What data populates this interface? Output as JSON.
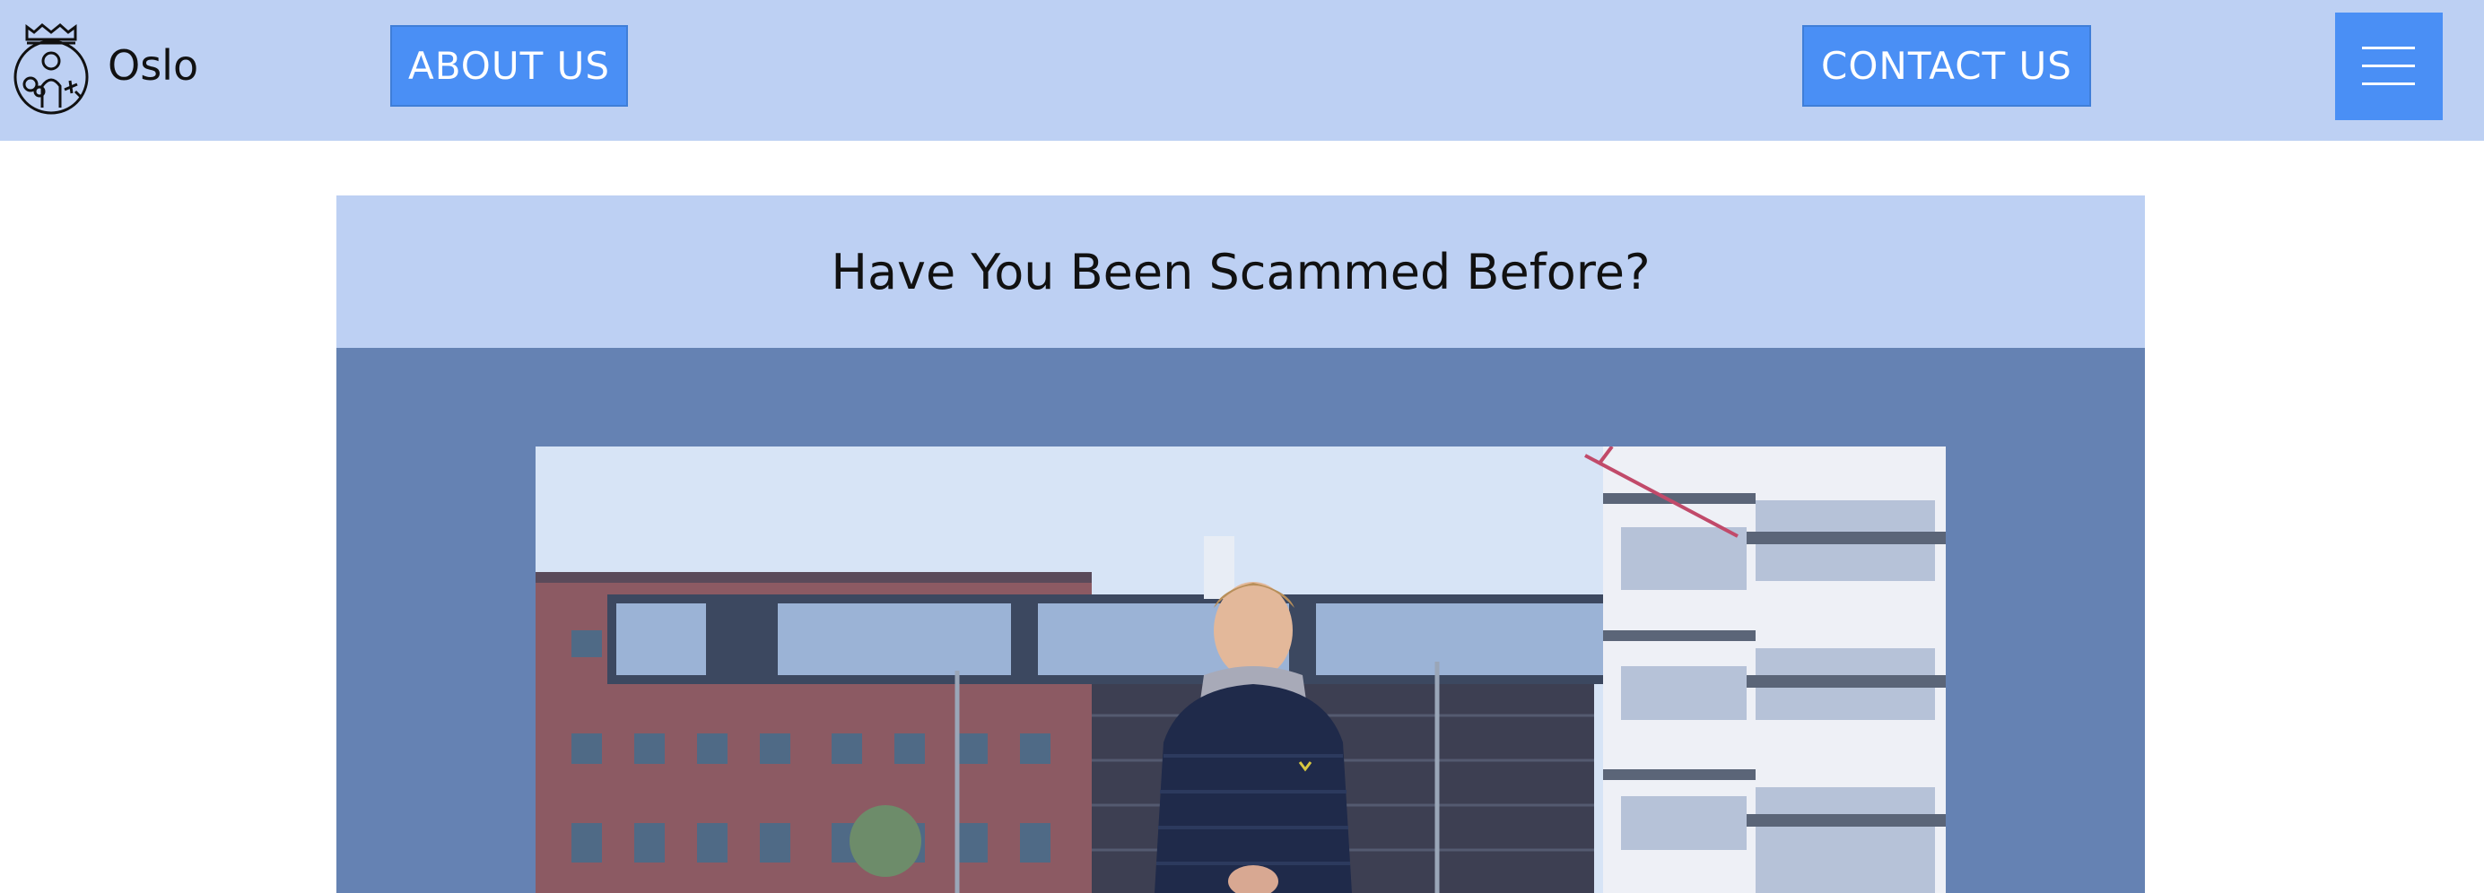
{
  "header": {
    "brand": "Oslo",
    "logo_icon": "oslo-city-seal-icon",
    "about_label": "ABOUT US",
    "contact_label": "CONTACT US",
    "menu_icon": "hamburger-menu-icon"
  },
  "banner": {
    "title": "Have You Been Scammed Before?"
  },
  "video": {
    "content": "video-thumbnail"
  },
  "colors": {
    "header_bg": "#bdd0f3",
    "button_bg": "#4a8ff5",
    "section_bg": "#6582b3",
    "text": "#111111"
  }
}
